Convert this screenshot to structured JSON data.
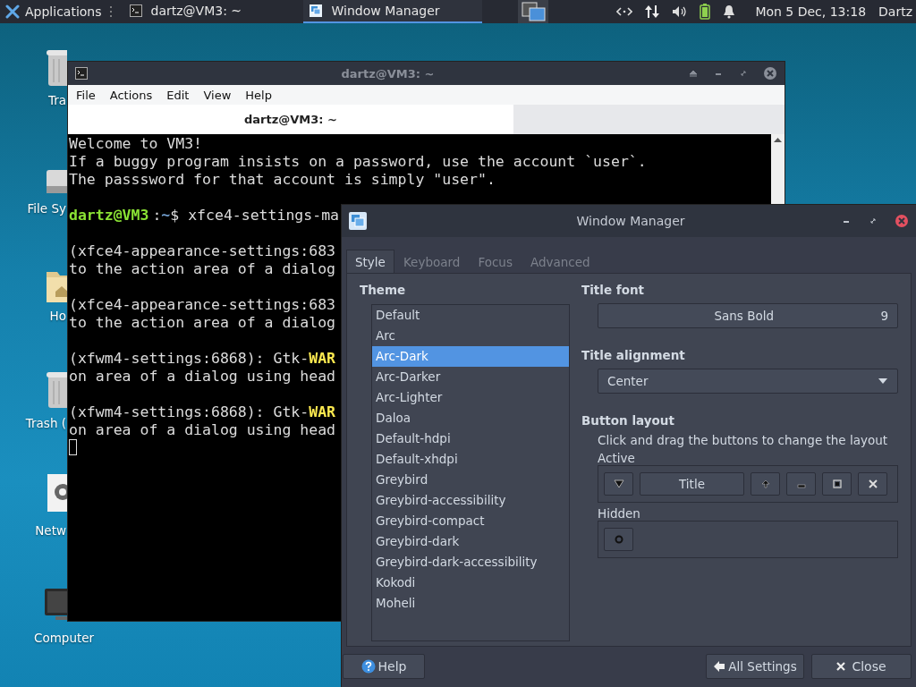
{
  "panel": {
    "applications": "Applications",
    "tasks": [
      {
        "label": "dartz@VM3: ~",
        "kind": "terminal",
        "selected": false
      },
      {
        "label": "Window Manager",
        "kind": "settings",
        "selected": true
      }
    ],
    "clock": "Mon  5 Dec, 13:18",
    "user": "Dartz"
  },
  "desktop_icons": [
    {
      "label": "Tra",
      "kind": "trash"
    },
    {
      "label": "File Sy",
      "kind": "drive"
    },
    {
      "label": "Ho",
      "kind": "folder"
    },
    {
      "label": "Trash (",
      "kind": "trash"
    },
    {
      "label": "Netw",
      "kind": "gear"
    },
    {
      "label": "Computer",
      "kind": "monitor"
    }
  ],
  "terminal": {
    "title": "dartz@VM3: ~",
    "menu": [
      "File",
      "Actions",
      "Edit",
      "View",
      "Help"
    ],
    "tab": "dartz@VM3: ~",
    "blocks": [
      {
        "lines": [
          [
            {
              "text": "Welcome to VM3!",
              "kind": "plain"
            }
          ],
          [
            {
              "text": "If a buggy program insists on a password, use the account `user`.",
              "kind": "plain"
            }
          ],
          [
            {
              "text": "The passsword for that account is simply \"user\".",
              "kind": "plain"
            }
          ]
        ]
      },
      {
        "lines": [
          [
            {
              "text": "dartz@VM3",
              "kind": "user"
            },
            {
              "text": ":",
              "kind": "plain"
            },
            {
              "text": "~",
              "kind": "path"
            },
            {
              "text": "$ xfce4-settings-ma",
              "kind": "plain"
            }
          ]
        ]
      },
      {
        "lines": [
          [
            {
              "text": "(xfce4-appearance-settings:683",
              "kind": "plain"
            }
          ],
          [
            {
              "text": "to the action area of a dialog",
              "kind": "plain"
            }
          ]
        ]
      },
      {
        "lines": [
          [
            {
              "text": "(xfce4-appearance-settings:683",
              "kind": "plain"
            }
          ],
          [
            {
              "text": "to the action area of a dialog",
              "kind": "plain"
            }
          ]
        ]
      },
      {
        "lines": [
          [
            {
              "text": "(xfwm4-settings:6868): Gtk-",
              "kind": "plain"
            },
            {
              "text": "WAR",
              "kind": "warn"
            }
          ],
          [
            {
              "text": "on area of a dialog using head",
              "kind": "plain"
            }
          ]
        ]
      },
      {
        "lines": [
          [
            {
              "text": "(xfwm4-settings:6868): Gtk-",
              "kind": "plain"
            },
            {
              "text": "WAR",
              "kind": "warn"
            }
          ],
          [
            {
              "text": "on area of a dialog using head",
              "kind": "plain"
            }
          ]
        ]
      }
    ]
  },
  "window_manager": {
    "title": "Window Manager",
    "tabs": [
      {
        "label": "Style",
        "selected": true
      },
      {
        "label": "Keyboard",
        "selected": false
      },
      {
        "label": "Focus",
        "selected": false
      },
      {
        "label": "Advanced",
        "selected": false
      }
    ],
    "theme": {
      "heading": "Theme",
      "items": [
        {
          "label": "Default",
          "selected": false
        },
        {
          "label": "Arc",
          "selected": false
        },
        {
          "label": "Arc-Dark",
          "selected": true
        },
        {
          "label": "Arc-Darker",
          "selected": false
        },
        {
          "label": "Arc-Lighter",
          "selected": false
        },
        {
          "label": "Daloa",
          "selected": false
        },
        {
          "label": "Default-hdpi",
          "selected": false
        },
        {
          "label": "Default-xhdpi",
          "selected": false
        },
        {
          "label": "Greybird",
          "selected": false
        },
        {
          "label": "Greybird-accessibility",
          "selected": false
        },
        {
          "label": "Greybird-compact",
          "selected": false
        },
        {
          "label": "Greybird-dark",
          "selected": false
        },
        {
          "label": "Greybird-dark-accessibility",
          "selected": false
        },
        {
          "label": "Kokodi",
          "selected": false
        },
        {
          "label": "Moheli",
          "selected": false
        }
      ]
    },
    "title_font": {
      "heading": "Title font",
      "name": "Sans Bold",
      "size": "9"
    },
    "title_alignment": {
      "heading": "Title alignment",
      "value": "Center"
    },
    "button_layout": {
      "heading": "Button layout",
      "hint": "Click and drag the buttons to change the layout",
      "active": {
        "label": "Active",
        "buttons": [
          {
            "kind": "menu"
          },
          {
            "kind": "title",
            "label": "Title"
          },
          {
            "kind": "shade"
          },
          {
            "kind": "hide"
          },
          {
            "kind": "maximize"
          },
          {
            "kind": "close"
          }
        ]
      },
      "hidden": {
        "label": "Hidden",
        "buttons": [
          {
            "kind": "stick"
          }
        ]
      }
    },
    "buttons": [
      {
        "label": "Help",
        "kind": "help"
      },
      {
        "label": "All Settings",
        "kind": "back"
      },
      {
        "label": "Close",
        "kind": "close"
      }
    ]
  }
}
